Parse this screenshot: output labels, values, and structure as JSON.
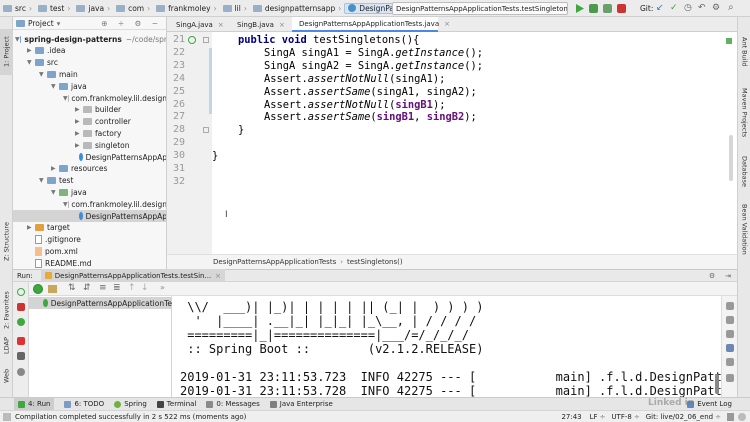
{
  "breadcrumb": [
    "src",
    "test",
    "java",
    "com",
    "frankmoley",
    "lil",
    "designpatternsapp",
    "DesignPatternsApp",
    "DesignPatternsAppApplicationTests.testSingletons"
  ],
  "toolbar": {
    "run_config": "DesignPatternsAppApplicationTests.testSingletons",
    "git_label": "Git:"
  },
  "project": {
    "header": "Project",
    "tree": [
      {
        "label": "spring-design-patterns",
        "suffix": "~/code/spr",
        "icon": "folder",
        "arrow": "▼"
      },
      {
        "label": ".idea",
        "icon": "folder",
        "arrow": "▶"
      },
      {
        "label": "src",
        "icon": "folder",
        "arrow": "▼"
      },
      {
        "label": "main",
        "icon": "folder",
        "arrow": "▼"
      },
      {
        "label": "java",
        "icon": "folder-blue",
        "arrow": "▼"
      },
      {
        "label": "com.frankmoley.lil.design",
        "icon": "package",
        "arrow": "▼"
      },
      {
        "label": "builder",
        "icon": "package",
        "arrow": "▶"
      },
      {
        "label": "controller",
        "icon": "package",
        "arrow": "▶"
      },
      {
        "label": "factory",
        "icon": "package",
        "arrow": "▶"
      },
      {
        "label": "singleton",
        "icon": "package",
        "arrow": "▶"
      },
      {
        "label": "DesignPatternsAppAp",
        "icon": "class",
        "arrow": ""
      },
      {
        "label": "resources",
        "icon": "folder",
        "arrow": "▶"
      },
      {
        "label": "test",
        "icon": "folder",
        "arrow": "▼"
      },
      {
        "label": "java",
        "icon": "folder-green",
        "arrow": "▼"
      },
      {
        "label": "com.frankmoley.lil.design",
        "icon": "package",
        "arrow": "▼"
      },
      {
        "label": "DesignPatternsAppAp",
        "icon": "class",
        "arrow": ""
      },
      {
        "label": "target",
        "icon": "folder-orange",
        "arrow": "▶"
      },
      {
        "label": ".gitignore",
        "icon": "file",
        "arrow": ""
      },
      {
        "label": "pom.xml",
        "icon": "xml",
        "arrow": ""
      },
      {
        "label": "README.md",
        "icon": "file",
        "arrow": ""
      }
    ]
  },
  "tabs": [
    "SingA.java",
    "SingB.java",
    "DesignPatternsAppApplicationTests.java"
  ],
  "editor": {
    "line_numbers": [
      "21",
      "22",
      "23",
      "24",
      "25",
      "26",
      "27",
      "28",
      "29",
      "30",
      "31",
      "32"
    ],
    "lines": [
      {
        "kw": "public void ",
        "rest": "testSingletons(){"
      },
      {
        "pre": "SingA singA1 = SingA.",
        "it": "getInstance",
        "post": "();"
      },
      {
        "pre": "SingA singA2 = SingA.",
        "it": "getInstance",
        "post": "();"
      },
      {
        "pre": "Assert.",
        "it": "assertNotNull",
        "post": "(singA1);"
      },
      {
        "pre": "Assert.",
        "it": "assertSame",
        "post": "(singA1, singA2);"
      },
      {
        "pre": "Assert.",
        "it": "assertNotNull",
        "post": "(",
        "var": "singB1",
        "post2": ");"
      },
      {
        "pre": "Assert.",
        "it": "assertSame",
        "post": "(",
        "var": "singB1",
        "mid": ", ",
        "var2": "singB2",
        "post2": ");"
      },
      {
        "text": "}"
      },
      {
        "text": ""
      },
      {
        "text": "}"
      },
      {
        "text": ""
      },
      {
        "text": ""
      }
    ],
    "breadcrumb": [
      "DesignPatternsAppApplicationTests",
      "testSingletons()"
    ]
  },
  "run": {
    "header_label": "Run:",
    "tab": "DesignPatternsAppApplicationTests.testSin...",
    "tree_item": "DesignPatternsAppApplicationTe",
    "console": [
      " \\\\/  ___)| |_)| | | | | || (_| |  ) ) ) )",
      "  '  |____| .__|_| |_|_| |_\\__, | / / / /",
      " =========|_|==============|___/=/_/_/_/",
      " :: Spring Boot ::        (v2.1.2.RELEASE)",
      "",
      "2019-01-31 23:11:53.723  INFO 42275 --- [           main] .f.l.d.DesignPatter",
      "2019-01-31 23:11:53.728  INFO 42275 --- [           main] .f.l.d.DesignPatter"
    ]
  },
  "bottom_tools": [
    "4: Run",
    "6: TODO",
    "Spring",
    "Terminal",
    "0: Messages",
    "Java Enterprise",
    "Event Log"
  ],
  "status": {
    "message": "Compilation completed successfully in 2 s 522 ms (moments ago)",
    "position": "27:43",
    "line_sep": "LF",
    "encoding": "UTF-8",
    "git": "Git: live/02_06_end"
  },
  "left_stripe": [
    "1: Project",
    "Z: Structure",
    "2: Favorites",
    "LDAP",
    "Web"
  ],
  "right_stripe": [
    "Ant Build",
    "Maven Projects",
    "Database",
    "Bean Validation"
  ],
  "watermark": "Linked in"
}
